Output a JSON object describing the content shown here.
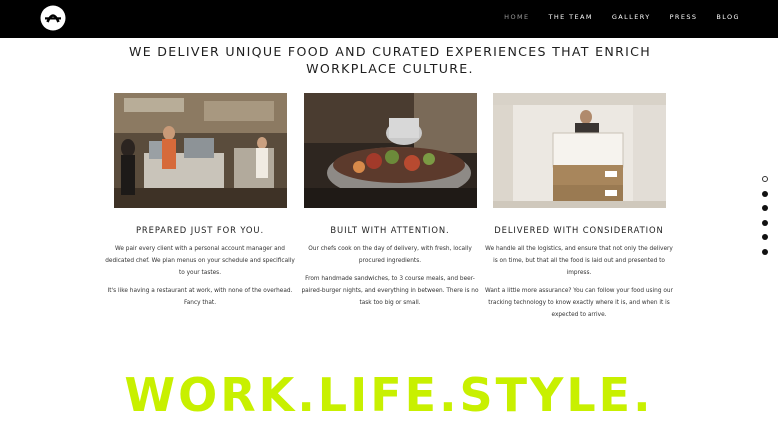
{
  "header": {
    "logo_icon": "circle-monogram-logo",
    "nav": [
      {
        "label": "HOME",
        "active": true
      },
      {
        "label": "THE TEAM",
        "active": false
      },
      {
        "label": "GALLERY",
        "active": false
      },
      {
        "label": "PRESS",
        "active": false
      },
      {
        "label": "BLOG",
        "active": false
      }
    ]
  },
  "hero": {
    "headline": "WE DELIVER UNIQUE FOOD AND CURATED EXPERIENCES THAT ENRICH WORKPLACE CULTURE."
  },
  "features": [
    {
      "image_icon": "kitchen-photo",
      "title": "PREPARED JUST FOR YOU.",
      "paragraphs": [
        "We pair every client with a personal account manager and dedicated chef. We plan menus on your schedule and specifically to your tastes.",
        "It's like having a restaurant at work, with none of the overhead. Fancy that."
      ]
    },
    {
      "image_icon": "salad-bowl-photo",
      "title": "BUILT WITH ATTENTION.",
      "paragraphs": [
        "Our chefs cook on the day of delivery, with fresh, locally procured ingredients.",
        "From handmade sandwiches, to 3 course meals, and beer-paired-burger nights, and everything in between. There is no task too big or small."
      ]
    },
    {
      "image_icon": "delivery-boxes-photo",
      "title": "DELIVERED WITH CONSIDERATION",
      "paragraphs": [
        "We handle all the logistics, and ensure that not only the delivery is on time, but that all the food is laid out and presented to impress.",
        "Want a little more assurance? You can follow your food using our tracking technology to know exactly where it is, and when it is expected to arrive."
      ]
    }
  ],
  "section_nav": {
    "count": 6,
    "active_index": 0
  },
  "tagline": "WORK.LIFE.STYLE.",
  "colors": {
    "accent": "#c8f000",
    "topbar": "#000000",
    "nav_active": "#9a9a9a"
  }
}
